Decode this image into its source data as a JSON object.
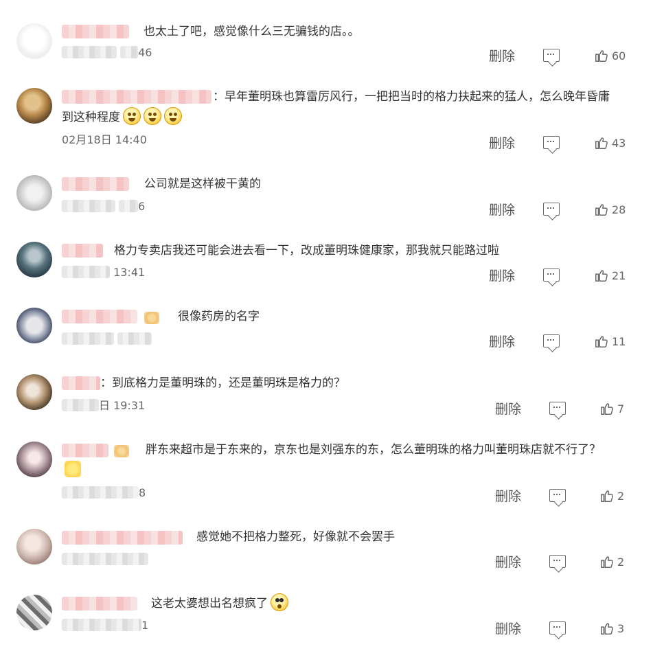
{
  "comments": [
    {
      "text": "也太土了吧，感觉像什么三无骗钱的店。。",
      "time": "46",
      "actions": {
        "delete": "删除",
        "likes": "60"
      }
    },
    {
      "text": "：早年董明珠也算雷厉风行，一把把当时的格力扶起来的猛人，怎么晚年昏庸",
      "text2": "到这种程度",
      "time": "02月18日 14:40",
      "actions": {
        "delete": "删除",
        "likes": "43"
      }
    },
    {
      "text": "公司就是这样被干黄的",
      "time": "6",
      "actions": {
        "delete": "删除",
        "likes": "28"
      }
    },
    {
      "text": "格力专卖店我还可能会进去看一下，改成董明珠健康家，那我就只能路过啦",
      "time": "13:41",
      "actions": {
        "delete": "删除",
        "likes": "21"
      }
    },
    {
      "text": "很像药房的名字",
      "time": "",
      "actions": {
        "delete": "删除",
        "likes": "11"
      }
    },
    {
      "text": "：到底格力是董明珠的，还是董明珠是格力的？",
      "time": "日 19:31",
      "actions": {
        "delete": "删除",
        "likes": "7"
      }
    },
    {
      "text": "胖东来超市是于东来的，京东也是刘强东的东，怎么董明珠的格力叫董明珠店就不行了？",
      "time": "8",
      "actions": {
        "delete": "删除",
        "likes": "2"
      }
    },
    {
      "text": "感觉她不把格力整死，好像就不会罢手",
      "time": "",
      "actions": {
        "delete": "删除",
        "likes": "2"
      }
    },
    {
      "text": "这老太婆想出名想疯了",
      "time": "1",
      "actions": {
        "delete": "删除",
        "likes": "3"
      }
    }
  ]
}
